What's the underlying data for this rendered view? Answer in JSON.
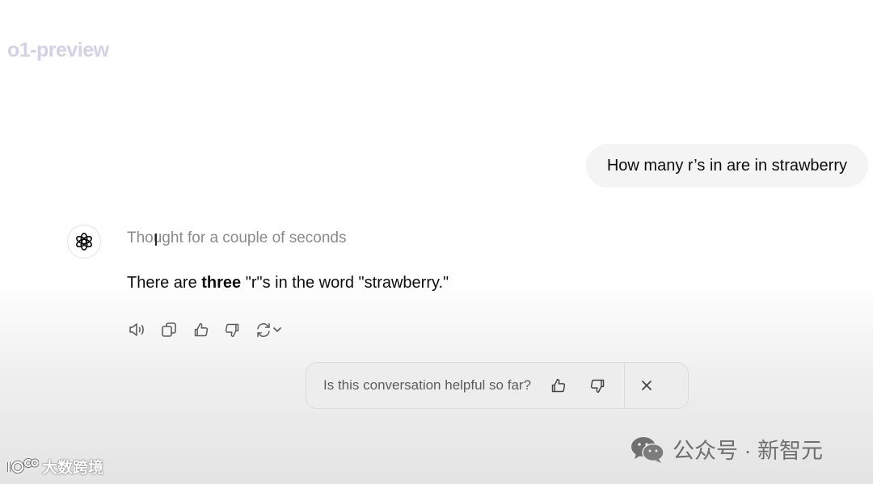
{
  "header": {
    "model_name": "o1-preview"
  },
  "conversation": {
    "user_message": "How many r’s in are in strawberry",
    "assistant": {
      "thought_label": "Thought for a couple of seconds",
      "answer_prefix": "There are ",
      "answer_bold": "three",
      "answer_suffix": " \"r\"s in the word \"strawberry.\""
    }
  },
  "message_actions": {
    "icons": [
      "speaker-icon",
      "copy-icon",
      "thumbs-up-icon",
      "thumbs-down-icon",
      "regenerate-icon",
      "chevron-down-icon"
    ]
  },
  "feedback": {
    "question": "Is this conversation helpful so far?"
  },
  "watermarks": {
    "right": "公众号 · 新智元",
    "left": "大数跨境"
  },
  "colors": {
    "model_title": "#d4d0e6",
    "user_bubble": "#f4f4f4",
    "muted_text": "#8a8a8a",
    "icon": "#5d5d5d"
  }
}
